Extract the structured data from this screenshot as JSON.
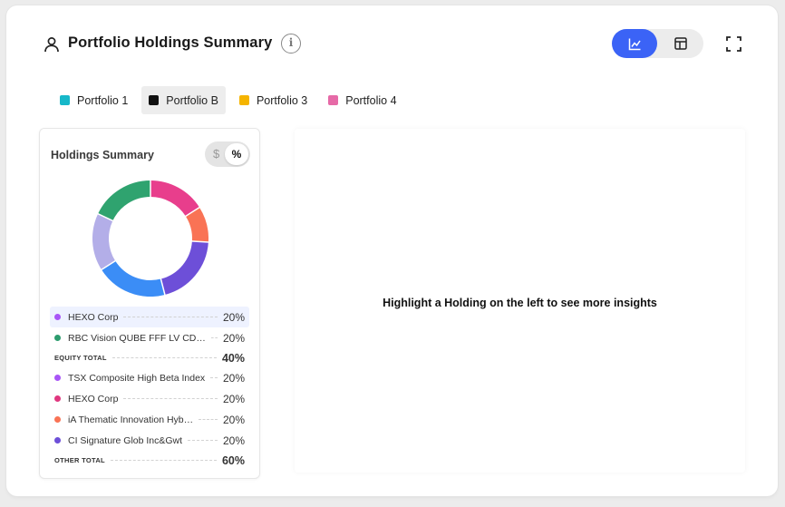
{
  "header": {
    "title": "Portfolio Holdings Summary",
    "info_icon": "info-icon",
    "user_icon": "user-icon",
    "view_options": [
      "chart-view-icon",
      "table-view-icon"
    ],
    "active_view": "chart",
    "expand_icon": "expand-icon",
    "accent_color": "#3b63f6"
  },
  "portfolios": [
    {
      "label": "Portfolio 1",
      "color": "#17b8c9",
      "active": false
    },
    {
      "label": "Portfolio B",
      "color": "#111111",
      "active": true
    },
    {
      "label": "Portfolio 3",
      "color": "#f5b400",
      "active": false
    },
    {
      "label": "Portfolio 4",
      "color": "#e66aa7",
      "active": false
    }
  ],
  "summary": {
    "title": "Holdings Summary",
    "unit_toggle": {
      "dollar": "$",
      "percent": "%",
      "selected": "%"
    },
    "holdings": [
      {
        "kind": "item",
        "name": "HEXO Corp",
        "pct": "20%",
        "dot": "#a855f7",
        "highlight": true
      },
      {
        "kind": "item",
        "name": "RBC Vision QUBE FFF LV CDN…",
        "pct": "20%",
        "dot": "#2d9c6e",
        "highlight": false
      },
      {
        "kind": "total",
        "name": "EQUITY TOTAL",
        "pct": "40%"
      },
      {
        "kind": "item",
        "name": "TSX Composite High Beta Index",
        "pct": "20%",
        "dot": "#a855f7",
        "highlight": false
      },
      {
        "kind": "item",
        "name": "HEXO Corp",
        "pct": "20%",
        "dot": "#e0377f",
        "highlight": false
      },
      {
        "kind": "item",
        "name": "iA Thematic Innovation Hyb…",
        "pct": "20%",
        "dot": "#f97355",
        "highlight": false
      },
      {
        "kind": "item",
        "name": "CI Signature Glob Inc&Gwt",
        "pct": "20%",
        "dot": "#6d4fd8",
        "highlight": false
      },
      {
        "kind": "total",
        "name": "OTHER TOTAL",
        "pct": "60%"
      }
    ],
    "donut_segments": [
      {
        "color": "#e83e8c",
        "value": 16
      },
      {
        "color": "#f97355",
        "value": 10
      },
      {
        "color": "#6d4fd8",
        "value": 20
      },
      {
        "color": "#3b8df6",
        "value": 20
      },
      {
        "color": "#b3aee8",
        "value": 16
      },
      {
        "color": "#2fa36f",
        "value": 18
      }
    ]
  },
  "insights": {
    "message": "Highlight a Holding on the left to see more insights"
  }
}
